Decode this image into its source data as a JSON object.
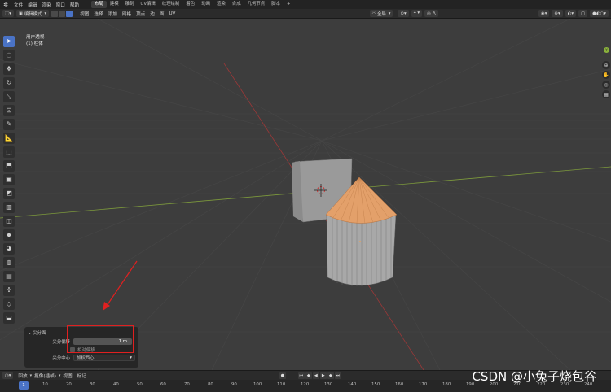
{
  "menubar": {
    "items": [
      "文件",
      "编辑",
      "渲染",
      "窗口",
      "帮助"
    ],
    "workspaces": [
      "布局",
      "建模",
      "雕刻",
      "UV编辑",
      "纹理绘制",
      "着色",
      "动画",
      "渲染",
      "合成",
      "几何节点",
      "脚本"
    ],
    "active_workspace_index": 0,
    "add_tab": "+"
  },
  "header": {
    "mode": "编辑模式",
    "menus": [
      "视图",
      "选择",
      "添加",
      "网格",
      "顶点",
      "边",
      "面",
      "UV"
    ],
    "transform_orientation": "全局"
  },
  "viewport": {
    "view_name": "用户透视",
    "object_name": "(1) 柱体"
  },
  "toolbar": {
    "tools": [
      "select-box",
      "cursor",
      "move",
      "rotate",
      "scale",
      "transform",
      "annotate",
      "measure",
      "add-cube",
      "extrude",
      "inset",
      "bevel",
      "loop-cut",
      "knife",
      "poly-build",
      "spin",
      "smooth",
      "edge-slide",
      "shrink-fatten",
      "shear",
      "rip"
    ],
    "active_index": 0
  },
  "operator_panel": {
    "title": "尖分面",
    "offset_label": "尖分偏移",
    "offset_value": "1 m",
    "relative_label": "相对偏移",
    "center_label": "尖分中心",
    "center_value": "加权西心"
  },
  "timeline": {
    "menus": [
      "回放",
      "抠像(插帧)",
      "视图",
      "标记"
    ],
    "current_frame": "1",
    "ticks": [
      "10",
      "20",
      "30",
      "40",
      "50",
      "60",
      "70",
      "80",
      "90",
      "100",
      "110",
      "120",
      "130",
      "140",
      "150",
      "160",
      "170",
      "180",
      "190",
      "200",
      "210",
      "220",
      "230",
      "240"
    ]
  },
  "watermark": "CSDN @小兔子烧包谷",
  "colors": {
    "accent": "#4a73c6",
    "viewport_bg": "#3d3d3d",
    "cone_top": "#e3a06a",
    "annotation_red": "#e02020"
  }
}
